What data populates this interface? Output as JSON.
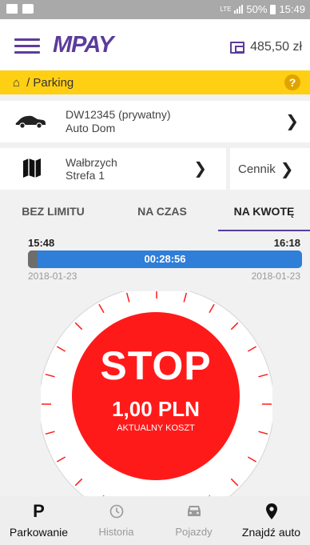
{
  "statusbar": {
    "network": "LTE",
    "battery": "50%",
    "time": "15:49"
  },
  "header": {
    "logo": "MPAY",
    "wallet_amount": "485,50 zł"
  },
  "breadcrumb": {
    "path": "/ Parking",
    "help": "?"
  },
  "vehicle": {
    "plate": "DW12345 (prywatny)",
    "name": "Auto Dom"
  },
  "zone": {
    "city": "Wałbrzych",
    "zone": "Strefa 1"
  },
  "pricing": {
    "label": "Cennik"
  },
  "tabs": [
    {
      "label": "BEZ LIMITU"
    },
    {
      "label": "NA CZAS"
    },
    {
      "label": "NA KWOTĘ"
    }
  ],
  "session": {
    "start_time": "15:48",
    "end_time": "16:18",
    "elapsed": "00:28:56",
    "start_date": "2018-01-23",
    "end_date": "2018-01-23",
    "progress": 0.035
  },
  "stop": {
    "label": "STOP",
    "amount": "1,00 PLN",
    "cost_label": "AKTUALNY KOSZT"
  },
  "colors": {
    "accent": "#5c3c9c",
    "breadcrumb": "#ffcf14",
    "stop": "#ff1a1a",
    "progress": "#2f7ed8"
  },
  "nav": [
    {
      "label": "Parkowanie",
      "icon": "parking-icon"
    },
    {
      "label": "Historia",
      "icon": "history-icon"
    },
    {
      "label": "Pojazdy",
      "icon": "car-icon"
    },
    {
      "label": "Znajdź auto",
      "icon": "location-pin-icon"
    }
  ]
}
